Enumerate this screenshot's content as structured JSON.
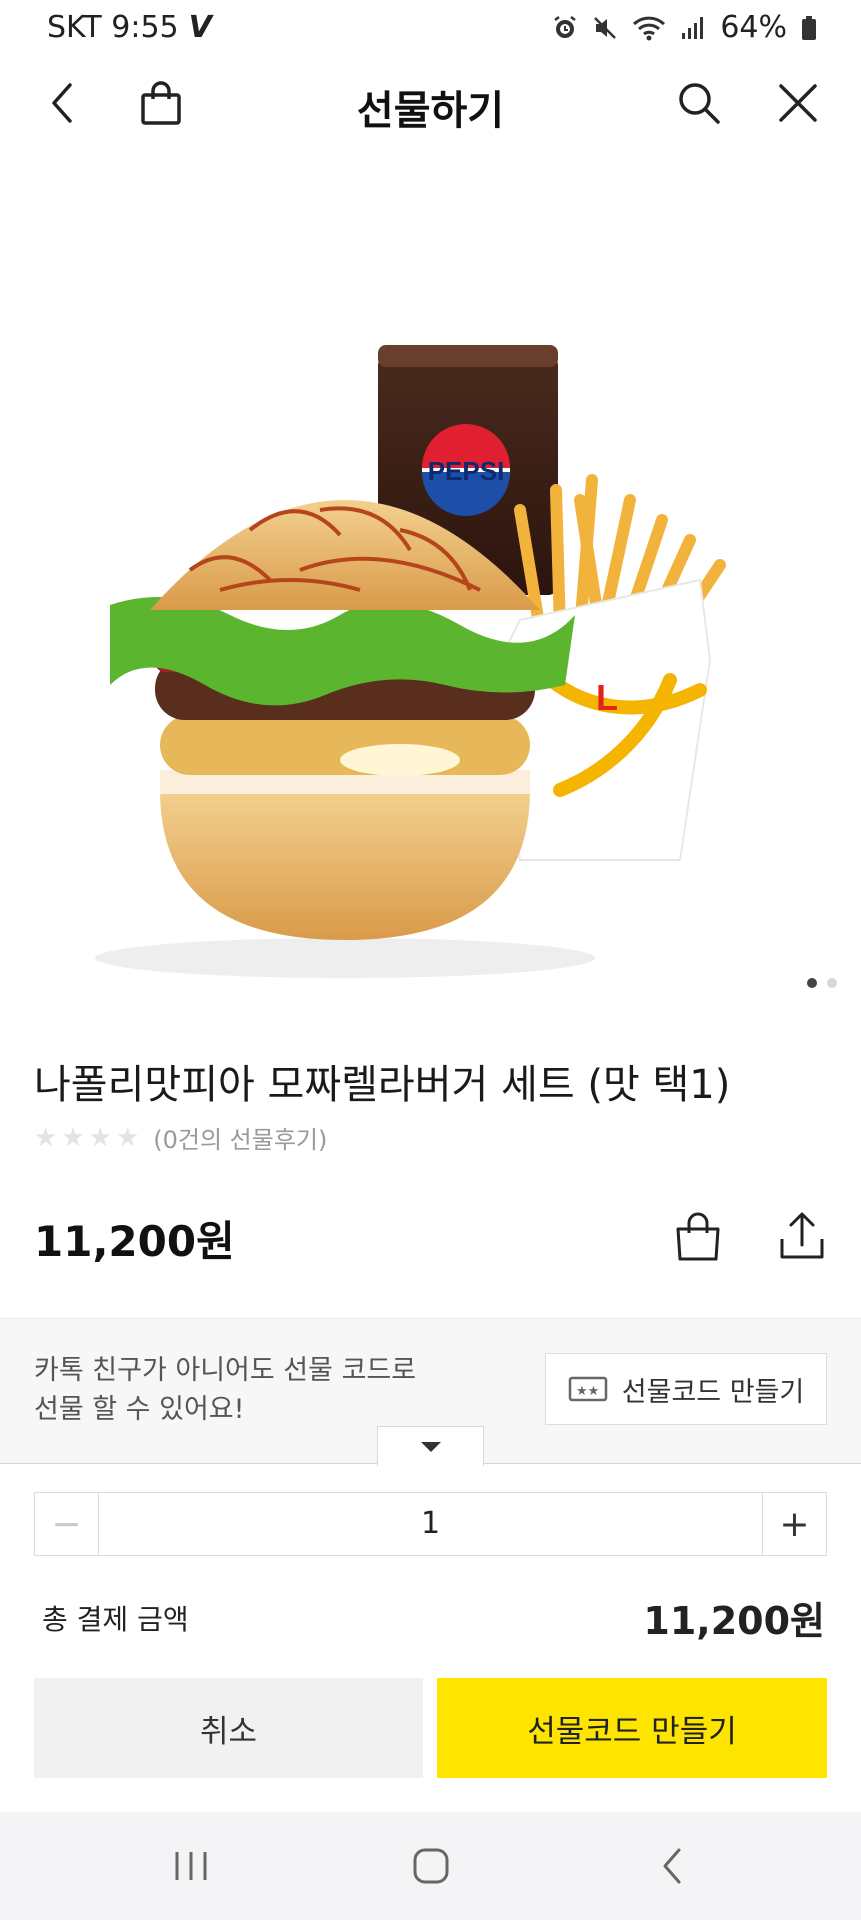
{
  "status_bar": {
    "carrier_time": "SKT 9:55",
    "carrier_logo": "V",
    "battery": "64%",
    "icons": [
      "alarm-icon",
      "mute-icon",
      "wifi-icon",
      "signal-icon",
      "battery-icon"
    ]
  },
  "header": {
    "title": "선물하기",
    "icons": [
      "back-icon",
      "shopping-bag-icon",
      "search-icon",
      "close-icon"
    ]
  },
  "product": {
    "image_alt": "",
    "image_brand_text": "PEPSI",
    "name": "나폴리맛피아 모짜렐라버거 세트 (맛 택1)",
    "rating_stars": 0,
    "rating_max": 5,
    "review_text": "(0건의 선물후기)",
    "price": "11,200원",
    "pager": {
      "count": 2,
      "active": 0
    }
  },
  "gift_bar": {
    "message_line1": "카톡 친구가 아니어도 선물 코드로",
    "message_line2": "선물 할 수 있어요!",
    "button_label": "선물코드 만들기"
  },
  "order": {
    "quantity": "1",
    "minus_label": "−",
    "plus_label": "+",
    "total_label": "총 결제 금액",
    "total_value": "11,200원",
    "cancel_label": "취소",
    "confirm_label": "선물코드 만들기"
  },
  "colors": {
    "accent": "#fee500",
    "cancel_bg": "#f1f1f1",
    "navbar_bg": "#f4f4f6"
  }
}
